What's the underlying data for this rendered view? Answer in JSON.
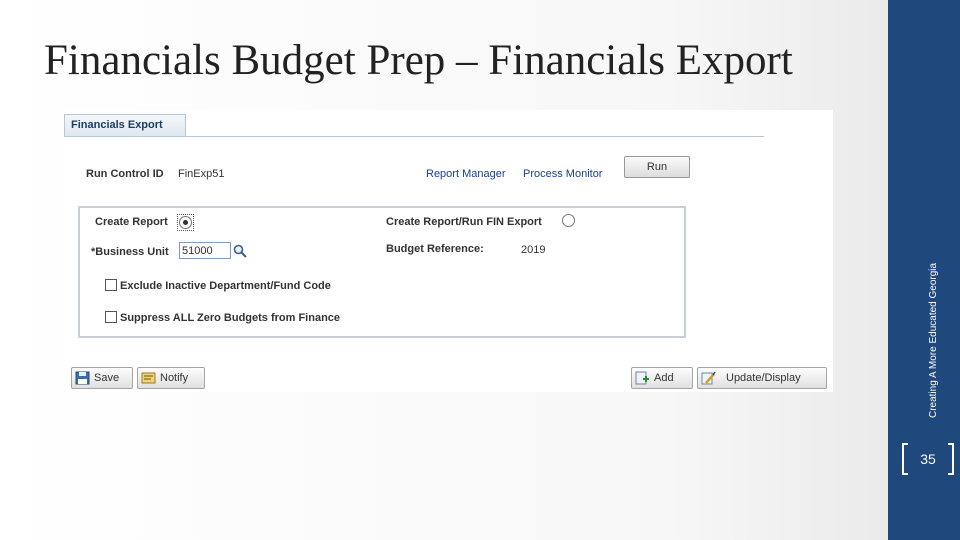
{
  "slide": {
    "title": "Financials Budget Prep – Financials Export",
    "side_caption": "Creating A More Educated Georgia",
    "page_number": "35"
  },
  "tab": {
    "label": "Financials Export"
  },
  "run_control": {
    "label": "Run Control ID",
    "value": "FinExp51"
  },
  "links": {
    "report_manager": "Report Manager",
    "process_monitor": "Process Monitor"
  },
  "run_button": "Run",
  "form": {
    "create_report_label": "Create Report",
    "create_report_selected": true,
    "create_run_fin_label": "Create Report/Run FIN Export",
    "create_run_fin_selected": false,
    "business_unit_label": "*Business Unit",
    "business_unit_value": "51000",
    "budget_reference_label": "Budget Reference:",
    "budget_reference_value": "2019",
    "exclude_inactive_label": "Exclude Inactive Department/Fund Code",
    "suppress_zero_label": "Suppress ALL Zero Budgets from Finance"
  },
  "toolbar": {
    "save_label": "Save",
    "notify_label": "Notify",
    "add_label": "Add",
    "update_display_label": "Update/Display"
  },
  "colors": {
    "band": "#1f497d",
    "link": "#1a3f8f"
  }
}
